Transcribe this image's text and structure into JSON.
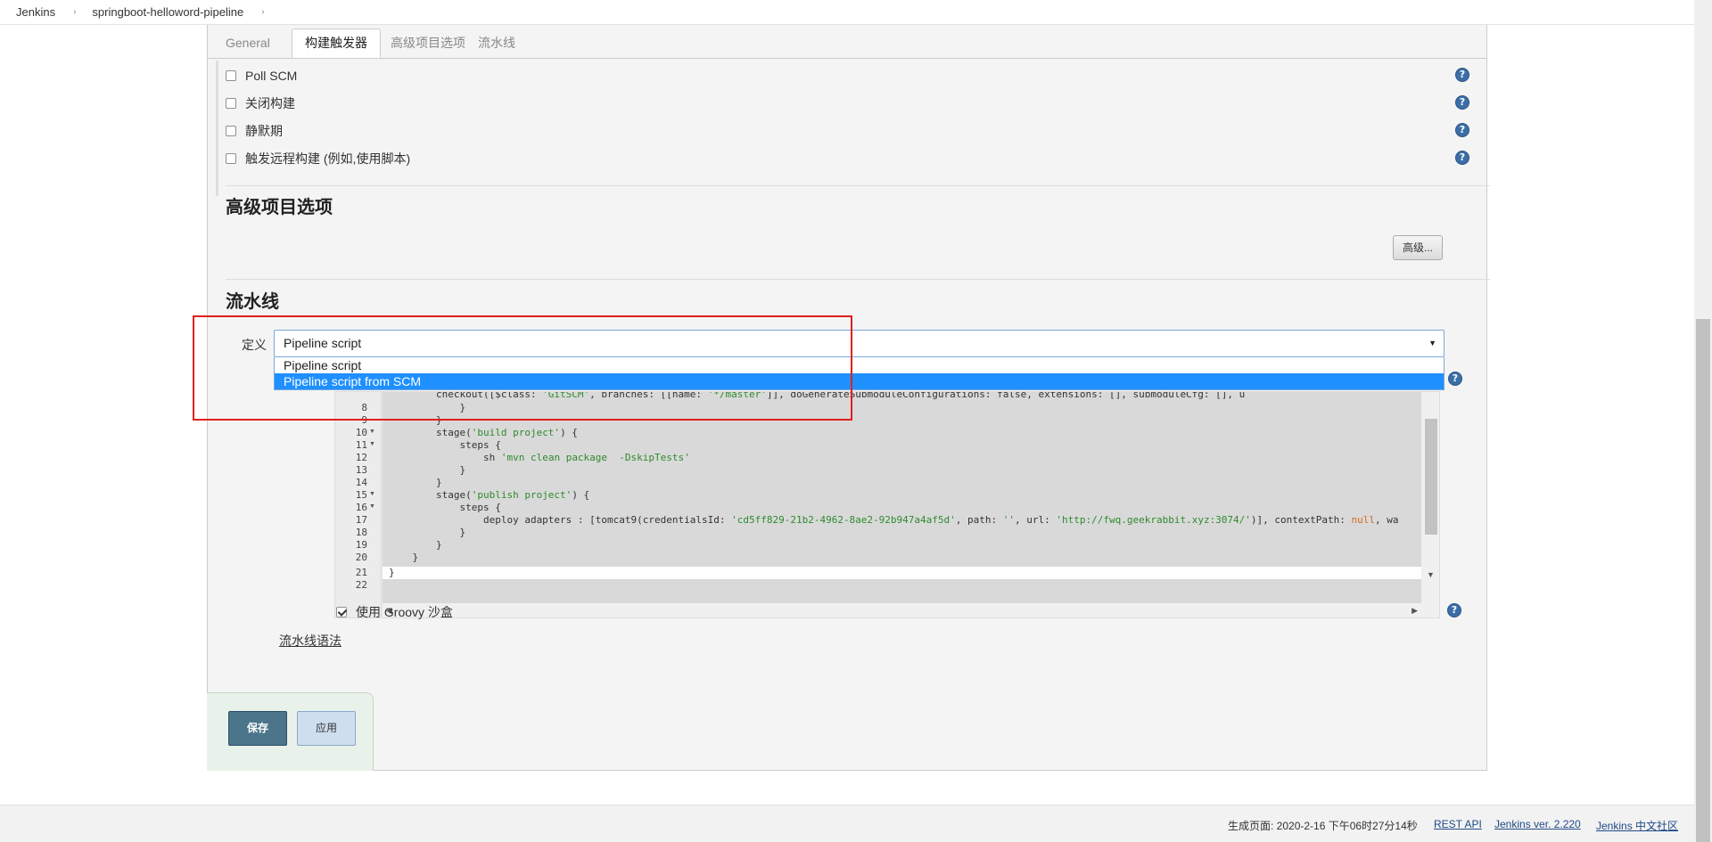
{
  "breadcrumb": {
    "items": [
      "Jenkins",
      "springboot-helloword-pipeline"
    ]
  },
  "tabs": [
    "General",
    "构建触发器",
    "高级项目选项",
    "流水线"
  ],
  "active_tab": "构建触发器",
  "triggers": [
    {
      "label": "Poll SCM",
      "checked": false
    },
    {
      "label": "关闭构建",
      "checked": false
    },
    {
      "label": "静默期",
      "checked": false
    },
    {
      "label": "触发远程构建 (例如,使用脚本)",
      "checked": false
    }
  ],
  "advanced_section": {
    "title": "高级项目选项",
    "button_label": "高级..."
  },
  "pipeline_section": {
    "title": "流水线",
    "definition_label": "定义",
    "definition_value": "Pipeline script",
    "dropdown_options": [
      "Pipeline script",
      "Pipeline script from SCM"
    ],
    "highlighted_option": "Pipeline script from SCM"
  },
  "code_editor": {
    "partial_line": "        checkout([$class: 'GitSCM', branches: [[name: '*/master']], doGenerateSubmoduleConfigurations: false, extensions: [], submoduleCfg: [], u",
    "lines": [
      {
        "n": "8",
        "text": "            }"
      },
      {
        "n": "9",
        "text": "        }"
      },
      {
        "n": "10",
        "text": "        stage('build project') {"
      },
      {
        "n": "11",
        "text": "            steps {"
      },
      {
        "n": "12",
        "text": "                sh 'mvn clean package  -DskipTests'"
      },
      {
        "n": "13",
        "text": "            }"
      },
      {
        "n": "14",
        "text": "        }"
      },
      {
        "n": "15",
        "text": "        stage('publish project') {"
      },
      {
        "n": "16",
        "text": "            steps {"
      },
      {
        "n": "17",
        "text": "                deploy adapters : [tomcat9(credentialsId: 'cd5ff829-21b2-4962-8ae2-92b947a4af5d', path: '', url: 'http://fwq.geekrabbit.xyz:3074/')], contextPath: null, wa"
      },
      {
        "n": "18",
        "text": "            }"
      },
      {
        "n": "19",
        "text": "        }"
      },
      {
        "n": "20",
        "text": "    }"
      },
      {
        "n": "21",
        "text": "}"
      },
      {
        "n": "22",
        "text": ""
      }
    ]
  },
  "sandbox": {
    "label": "使用 Groovy 沙盒",
    "checked": true
  },
  "syntax_link": "流水线语法",
  "buttons": {
    "save": "保存",
    "apply": "应用"
  },
  "footer": {
    "generated": "生成页面: 2020-2-16 下午06时27分14秒",
    "rest_api": "REST API",
    "version": "Jenkins ver. 2.220",
    "community": "Jenkins 中文社区"
  }
}
